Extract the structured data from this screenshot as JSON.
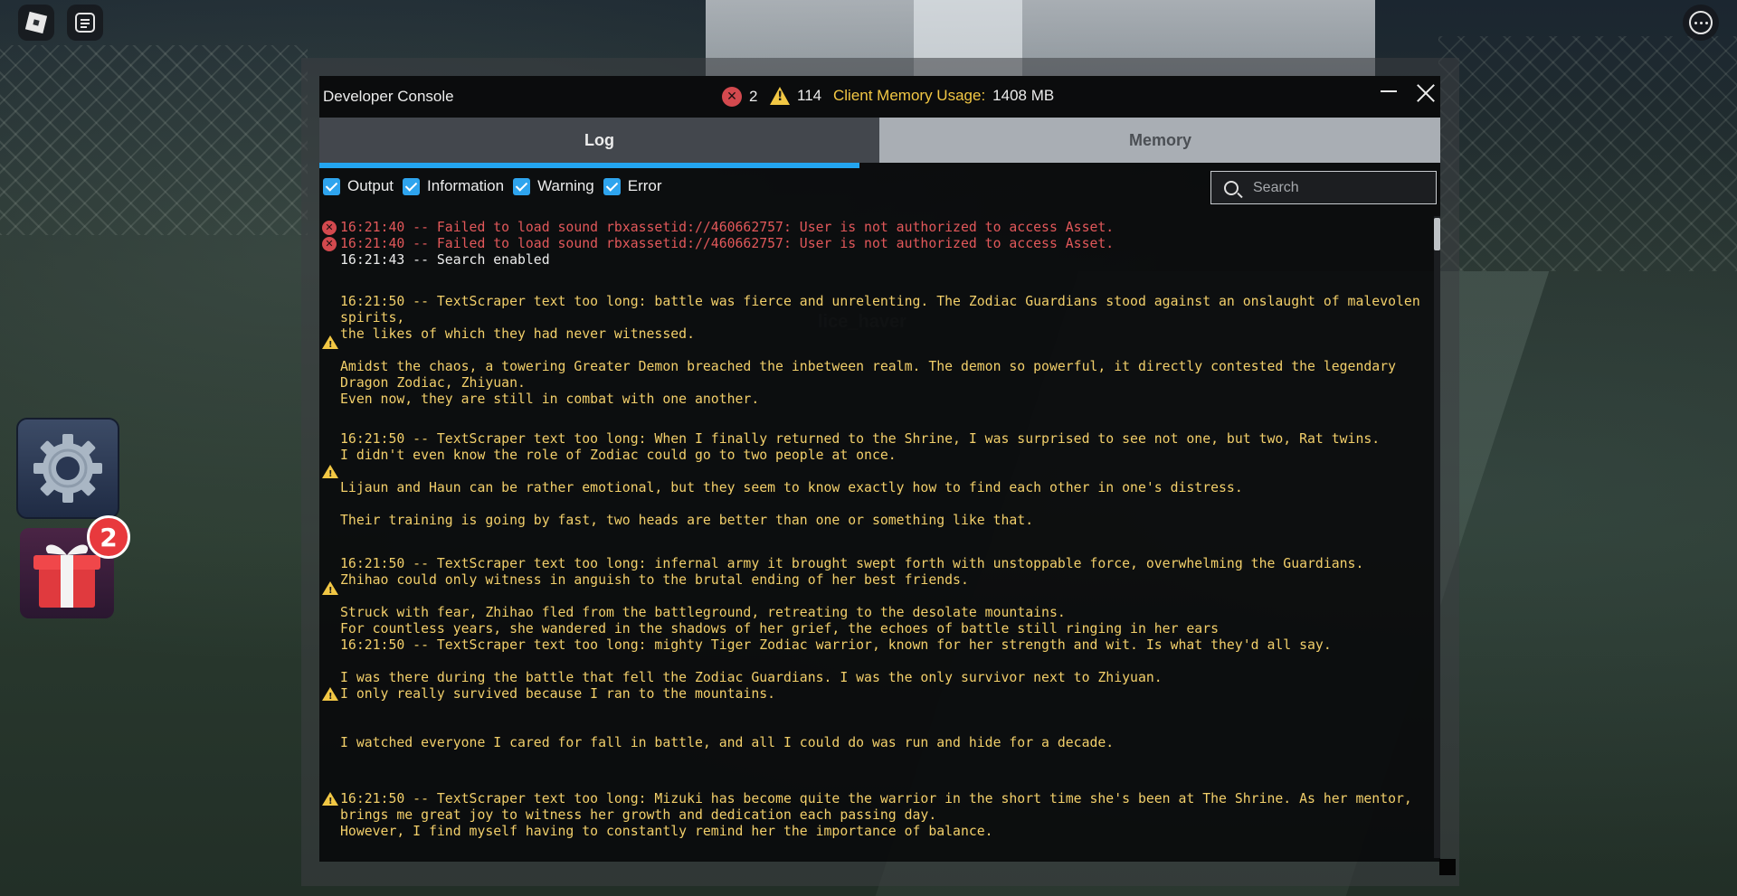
{
  "console": {
    "title": "Developer Console",
    "error_count": "2",
    "warning_count": "114",
    "memory_label": "Client Memory Usage:",
    "memory_value": "1408 MB",
    "tabs": [
      {
        "label": "Log",
        "active": true
      },
      {
        "label": "Memory",
        "active": false
      }
    ],
    "filters": [
      {
        "label": "Output",
        "checked": true
      },
      {
        "label": "Information",
        "checked": true
      },
      {
        "label": "Warning",
        "checked": true
      },
      {
        "label": "Error",
        "checked": true
      }
    ],
    "search_placeholder": "Search",
    "accent_color": "#23a5f0",
    "log": [
      {
        "type": "error",
        "lines": [
          "16:21:40 -- Failed to load sound rbxassetid://460662757: User is not authorized to access Asset."
        ]
      },
      {
        "type": "error",
        "lines": [
          "16:21:40 -- Failed to load sound rbxassetid://460662757: User is not authorized to access Asset."
        ]
      },
      {
        "type": "output",
        "lines": [
          "16:21:43 -- Search enabled"
        ]
      },
      {
        "type": "warning",
        "lines": [
          "",
          "16:21:50 -- TextScraper text too long: battle was fierce and unrelenting. The Zodiac Guardians stood against an onslaught of malevolen",
          "spirits,",
          "the likes of which they had never witnessed.",
          "",
          "Amidst the chaos, a towering Greater Demon breached the inbetween realm. The demon so powerful, it directly contested the legendary",
          "Dragon Zodiac, Zhiyuan.",
          "Even now, they are still in combat with one another."
        ]
      },
      {
        "type": "warning",
        "lines": [
          "",
          "16:21:50 -- TextScraper text too long: When I finally returned to the Shrine, I was surprised to see not one, but two, Rat twins.",
          "I didn't even know the role of Zodiac could go to two people at once.",
          "",
          "Lijaun and Haun can be rather emotional, but they seem to know exactly how to find each other in one's distress.",
          "",
          "Their training is going by fast, two heads are better than one or something like that."
        ]
      },
      {
        "type": "warning",
        "lines": [
          "",
          "16:21:50 -- TextScraper text too long: infernal army it brought swept forth with unstoppable force, overwhelming the Guardians.",
          "Zhihao could only witness in anguish to the brutal ending of her best friends.",
          "",
          "Struck with fear, Zhihao fled from the battleground, retreating to the desolate mountains.",
          "For countless years, she wandered in the shadows of her grief, the echoes of battle still ringing in her ears"
        ]
      },
      {
        "type": "warning",
        "lines": [
          "16:21:50 -- TextScraper text too long: mighty Tiger Zodiac warrior, known for her strength and wit. Is what they'd all say.",
          "",
          "I was there during the battle that fell the Zodiac Guardians. I was the only survivor next to Zhiyuan.",
          "I only really survived because I ran to the mountains.",
          "",
          "",
          "I watched everyone I cared for fall in battle, and all I could do was run and hide for a decade."
        ]
      },
      {
        "type": "warning",
        "lines": [
          "",
          "",
          "16:21:50 -- TextScraper text too long: Mizuki has become quite the warrior in the short time she's been at The Shrine. As her mentor,",
          "brings me great joy to witness her growth and dedication each passing day.",
          "However, I find myself having to constantly remind her the importance of balance."
        ]
      }
    ]
  },
  "world": {
    "player_name": "lice_haver",
    "gift_badge_count": "2"
  },
  "icons": {
    "roblox": "roblox-logo-icon",
    "chat": "chat-icon",
    "more": "more-options-icon",
    "settings": "gear-icon",
    "gift": "gift-icon"
  }
}
